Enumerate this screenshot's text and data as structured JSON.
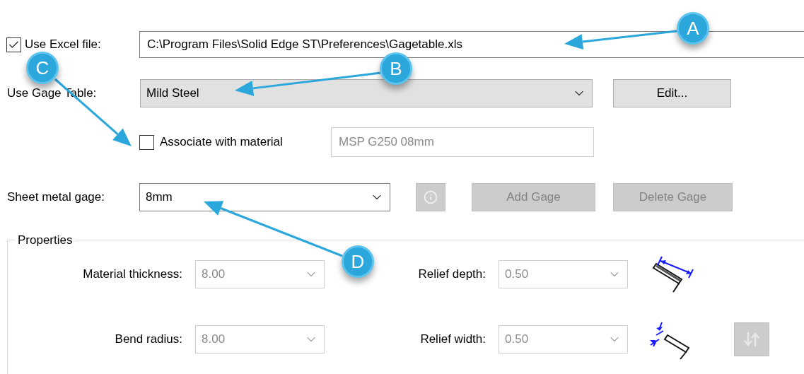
{
  "excel_file": {
    "label": "Use Excel file:",
    "checked": true,
    "value": "C:\\Program Files\\Solid Edge ST\\Preferences\\Gagetable.xls"
  },
  "gage_table": {
    "label": "Use Gage Table:",
    "value": "Mild Steel",
    "button": "Edit..."
  },
  "associate": {
    "label": "Associate with material",
    "checked": false,
    "material": "MSP G250 08mm"
  },
  "sheet_metal_gage": {
    "label": "Sheet metal gage:",
    "value": "8mm",
    "info_disabled": true
  },
  "gage_buttons": [
    {
      "label": "Add Gage",
      "disabled": true
    },
    {
      "label": "Delete Gage",
      "disabled": true
    }
  ],
  "properties": {
    "title": "Properties",
    "swap_disabled": true,
    "fields": [
      {
        "label": "Material thickness:",
        "value": "8.00",
        "disabled": true
      },
      {
        "label": "Relief depth:",
        "value": "0.50",
        "disabled": true
      },
      {
        "label": "Bend radius:",
        "value": "8.00",
        "disabled": true
      },
      {
        "label": "Relief width:",
        "value": "0.50",
        "disabled": true
      }
    ]
  },
  "callouts": [
    {
      "label": "A"
    },
    {
      "label": "B"
    },
    {
      "label": "C"
    },
    {
      "label": "D"
    }
  ]
}
